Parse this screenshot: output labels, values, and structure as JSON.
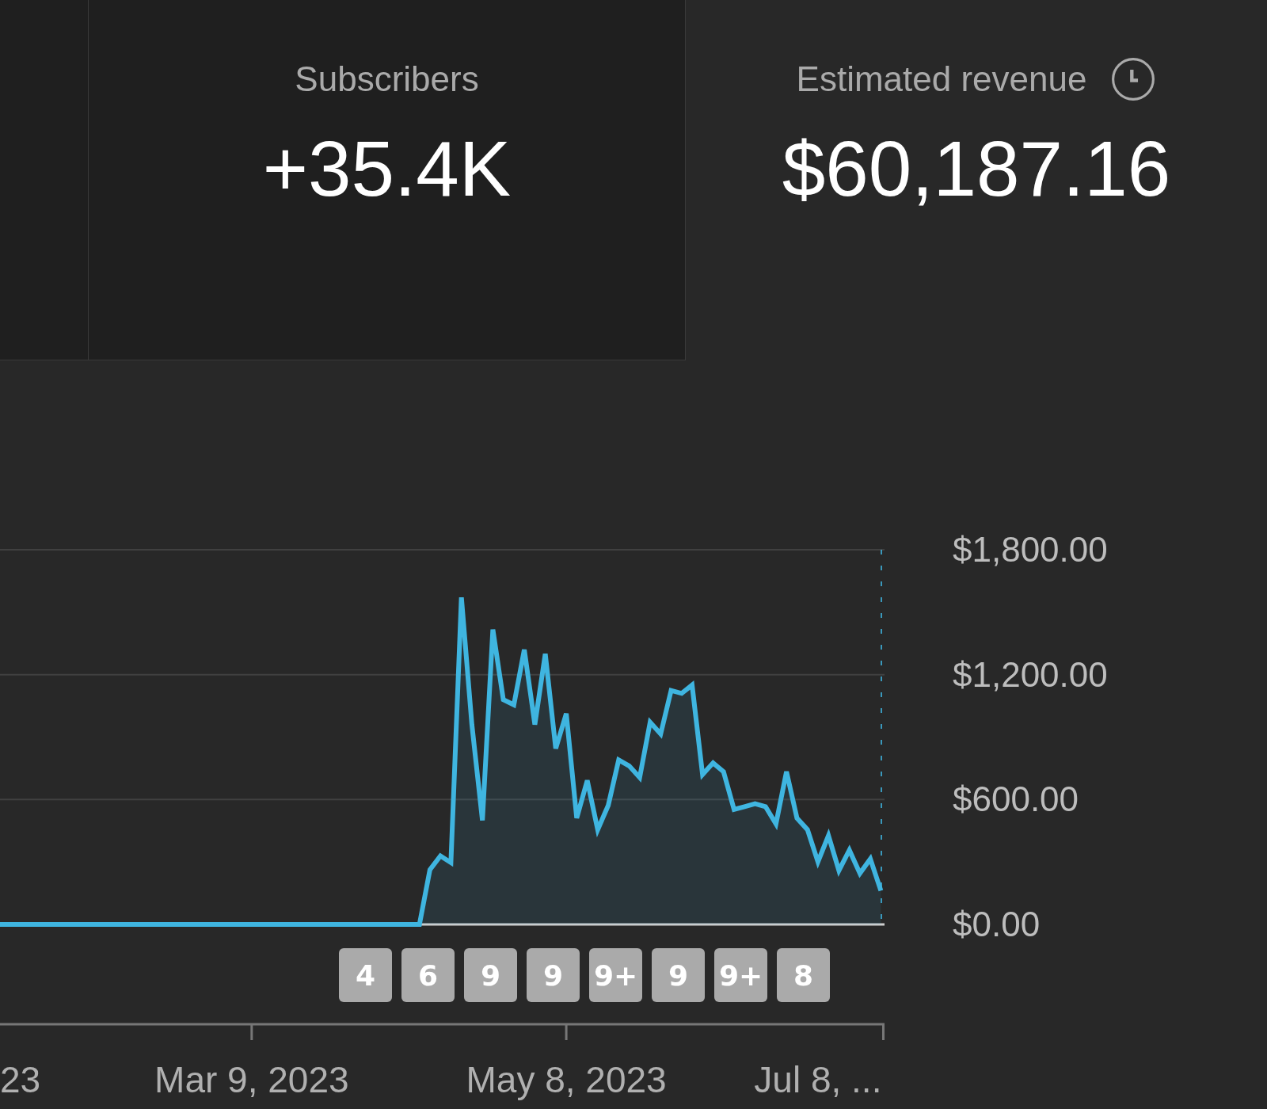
{
  "metric_cards": [
    {
      "kind": "blank",
      "selected": false
    },
    {
      "kind": "plain",
      "label": "Subscribers",
      "value": "+35.4K",
      "selected": false
    },
    {
      "kind": "timed",
      "label": "Estimated revenue",
      "value": "$60,187.16",
      "selected": true
    }
  ],
  "chart": {
    "chart_data": {
      "type": "area",
      "categories": [
        null,
        null,
        null,
        null,
        null,
        null,
        null,
        null,
        null,
        null,
        null,
        null,
        null,
        null,
        null,
        null,
        null,
        null,
        null,
        null,
        null,
        null,
        null,
        null,
        "Mar 9, 2023",
        null,
        null,
        null,
        null,
        null,
        null,
        null,
        null,
        null,
        null,
        null,
        null,
        null,
        null,
        null,
        null,
        null,
        null,
        null,
        null,
        null,
        null,
        null,
        null,
        null,
        null,
        null,
        null,
        null,
        "May 8, 2023",
        null,
        null,
        null,
        null,
        null,
        null,
        null,
        null,
        null,
        null,
        null,
        null,
        null,
        null,
        null,
        null,
        null,
        null,
        null,
        null,
        null,
        null,
        null,
        "Jul 8, ...",
        null,
        null,
        null,
        null,
        null,
        null
      ],
      "series": [
        {
          "color": "#3fb5e0",
          "values": [
            0,
            0,
            0,
            0,
            0,
            0,
            0,
            0,
            0,
            0,
            0,
            0,
            0,
            0,
            0,
            0,
            0,
            0,
            0,
            0,
            0,
            0,
            0,
            0,
            0,
            0,
            0,
            0,
            0,
            0,
            0,
            0,
            0,
            0,
            0,
            0,
            0,
            0,
            0,
            0,
            0,
            263,
            329,
            297,
            1571,
            960,
            500,
            1417,
            1080,
            1055,
            1320,
            960,
            1300,
            845,
            1013,
            511,
            692,
            455,
            572,
            790,
            762,
            706,
            971,
            915,
            1124,
            1110,
            1150,
            720,
            776,
            734,
            552,
            566,
            580,
            566,
            483,
            734,
            511,
            455,
            301,
            427,
            259,
            357,
            245,
            315,
            162
          ]
        }
      ],
      "ylim": [
        0,
        1800
      ],
      "yticks": [
        {
          "value": 0,
          "label": "$0.00"
        },
        {
          "value": 600,
          "label": "$600.00"
        },
        {
          "value": 1200,
          "label": "$1,200.00"
        },
        {
          "value": 1800,
          "label": "$1,800.00"
        }
      ]
    },
    "clipped_x_label": "23",
    "video_markers": [
      {
        "label": "4"
      },
      {
        "label": "6"
      },
      {
        "label": "9"
      },
      {
        "label": "9"
      },
      {
        "label": "9+"
      },
      {
        "label": "9"
      },
      {
        "label": "9+"
      },
      {
        "label": "8"
      }
    ]
  }
}
